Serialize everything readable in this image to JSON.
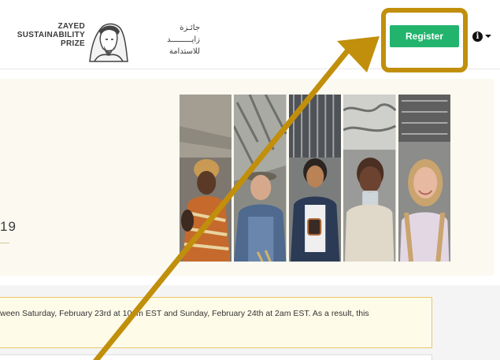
{
  "header": {
    "logo": {
      "en_lines": [
        "ZAYED",
        "SUSTAINABILITY",
        "PRIZE"
      ],
      "ar_lines": [
        "جائـزة",
        "زايـــــــــد",
        "للاستدامة"
      ]
    },
    "register_label": "Register",
    "info_icon": "info-icon"
  },
  "hero": {
    "year_fragment": "19"
  },
  "alert": {
    "text": "ween Saturday, February 23rd at 10pm EST and Sunday, February 24th at 2am EST. As a result, this"
  },
  "colors": {
    "register_green": "#22b46d",
    "annotation_gold": "#c18f0b",
    "alert_border": "#e8c66a",
    "hero_bg": "#fbf9f0"
  }
}
